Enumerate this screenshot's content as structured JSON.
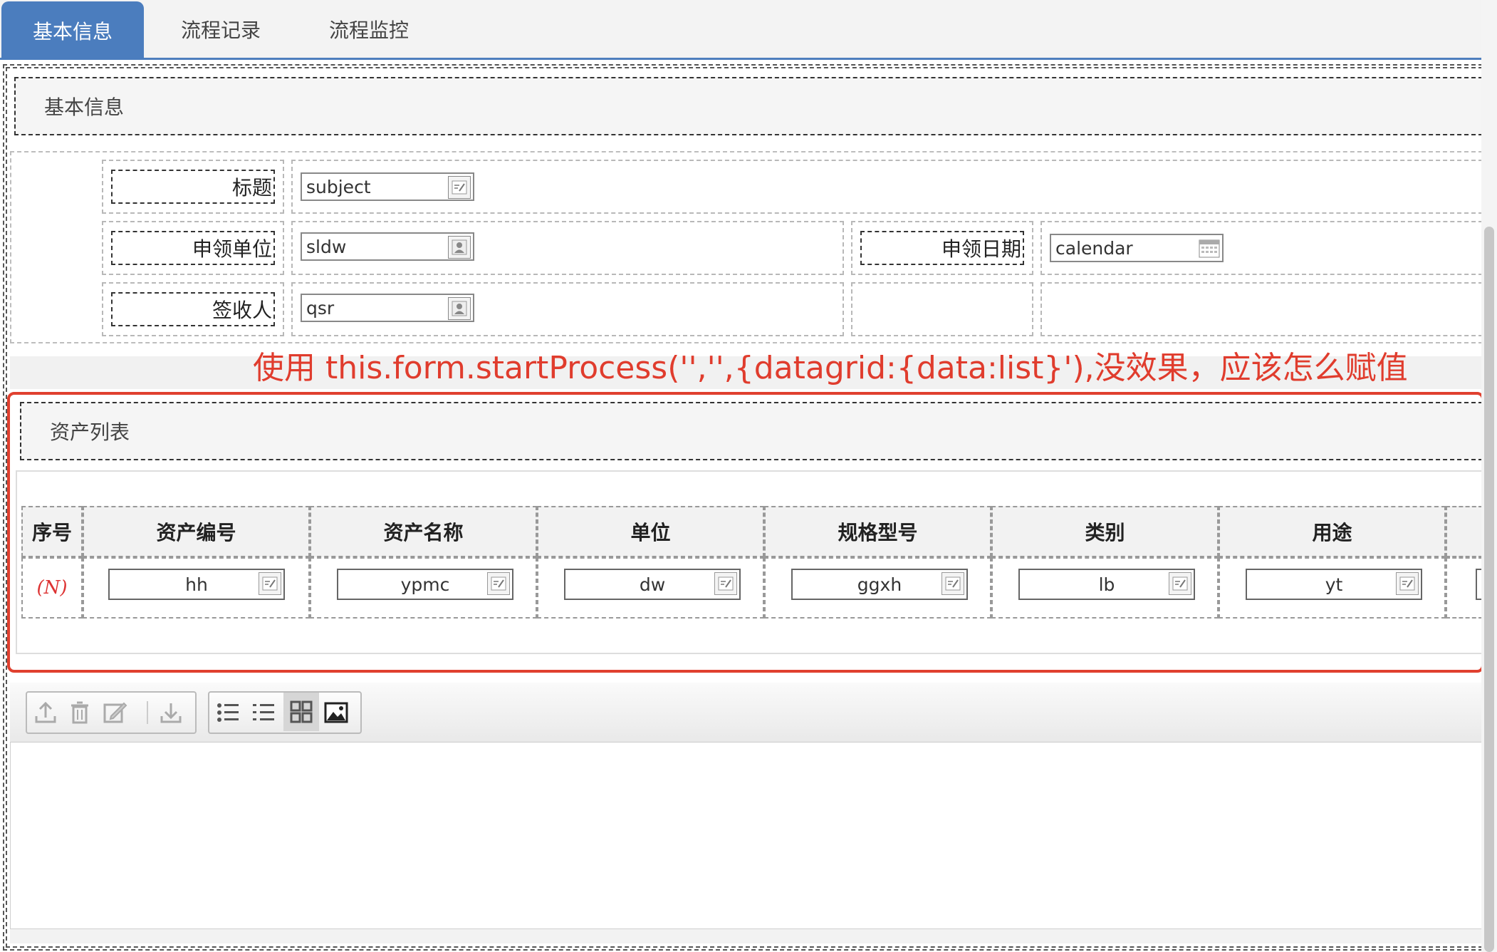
{
  "tabs": [
    {
      "label": "基本信息",
      "active": true
    },
    {
      "label": "流程记录",
      "active": false
    },
    {
      "label": "流程监控",
      "active": false
    }
  ],
  "basic_section": {
    "title": "基本信息"
  },
  "form": {
    "title_label": "标题",
    "title_value": "subject",
    "unit_label": "申领单位",
    "unit_value": "sldw",
    "date_label": "申领日期",
    "date_value": "calendar",
    "receiver_label": "签收人",
    "receiver_value": "qsr"
  },
  "annotation": "使用 this.form.startProcess('','',{datagrid:{data:list}'),没效果，应该怎么赋值",
  "asset_section": {
    "title": "资产列表"
  },
  "asset_table": {
    "headers": [
      "序号",
      "资产编号",
      "资产名称",
      "单位",
      "规格型号",
      "类别",
      "用途"
    ],
    "row_no": "(N)",
    "row_values": [
      "hh",
      "ypmc",
      "dw",
      "ggxh",
      "lb",
      "yt"
    ]
  },
  "toolbar": {
    "icons": [
      "upload-icon",
      "delete-icon",
      "edit-icon",
      "download-icon",
      "list-icon",
      "ordered-list-icon",
      "grid-icon",
      "image-icon"
    ]
  },
  "colors": {
    "tab_active": "#4b7dbe",
    "annotation": "#e03c2d"
  }
}
